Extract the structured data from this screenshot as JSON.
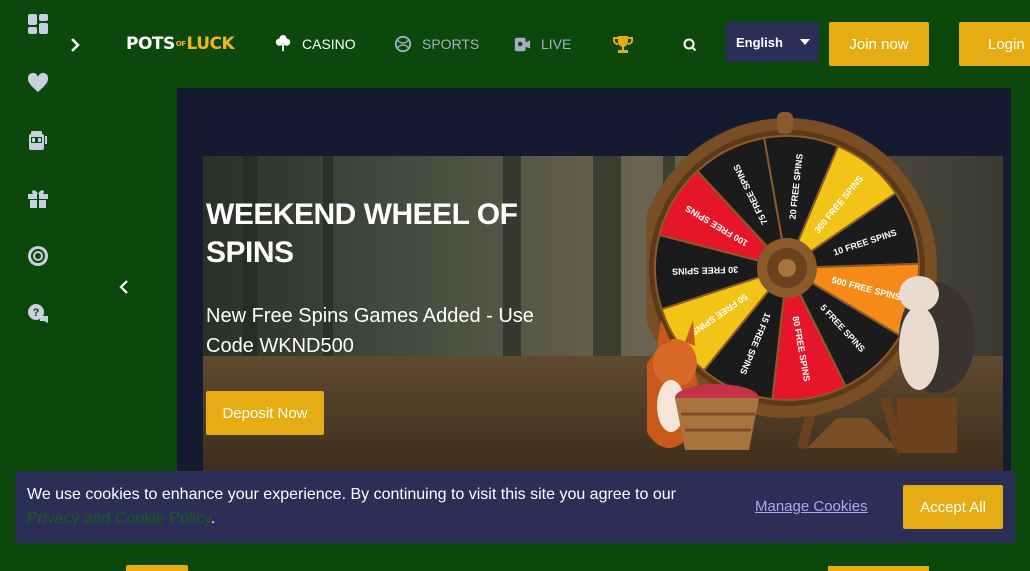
{
  "rail": {
    "items": [
      {
        "icon": "dashboard-icon"
      },
      {
        "icon": "heart-icon"
      },
      {
        "icon": "slot-machine-icon"
      },
      {
        "icon": "gift-icon"
      },
      {
        "icon": "lifebuoy-icon"
      },
      {
        "icon": "help-chat-icon"
      }
    ]
  },
  "header": {
    "logo": {
      "part1": "POTS",
      "part2": "OF",
      "part3": "LUCK"
    },
    "nav": [
      {
        "label": "CASINO",
        "icon": "clover-icon",
        "active": true
      },
      {
        "label": "SPORTS",
        "icon": "ball-icon",
        "active": false
      },
      {
        "label": "LIVE",
        "icon": "live-dealer-icon",
        "active": false
      }
    ],
    "language": "English",
    "join_label": "Join now",
    "login_label": "Login"
  },
  "hero": {
    "title": "WEEKEND WHEEL OF SPINS",
    "subtitle": "New Free Spins Games Added - Use Code WKND500",
    "cta_label": "Deposit Now",
    "wheel_labels": [
      "20 FREE SPINS",
      "300 FREE SPINS",
      "10 FREE SPINS",
      "500 FREE SPINS",
      "5 FREE SPINS",
      "80 FREE SPINS",
      "15 FREE SPINS",
      "50 FREE SPINS",
      "30 FREE SPINS",
      "100 FREE SPINS",
      "75 FREE SPINS"
    ]
  },
  "cookie": {
    "text_before": "We use cookies to enhance your experience. By continuing to visit this site you agree to our ",
    "policy_link": "Privacy and Cookie Policy",
    "text_after": ".",
    "manage_label": "Manage Cookies",
    "accept_label": "Accept All"
  },
  "colors": {
    "background": "#0c470c",
    "accent": "#e6ac13",
    "panel": "#2b2f58",
    "link": "#a7a9f2"
  }
}
